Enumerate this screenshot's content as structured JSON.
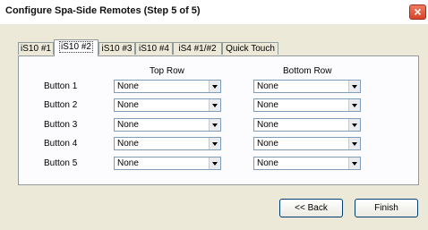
{
  "window": {
    "title": "Configure Spa-Side Remotes (Step 5 of 5)"
  },
  "tabs": [
    {
      "label": "iS10 #1"
    },
    {
      "label": "iS10 #2",
      "active": true
    },
    {
      "label": "iS10 #3"
    },
    {
      "label": "iS10 #4"
    },
    {
      "label": "iS4 #1/#2"
    },
    {
      "label": "Quick Touch"
    }
  ],
  "columns": {
    "top_row": "Top Row",
    "bottom_row": "Bottom Row"
  },
  "rows": [
    {
      "label": "Button 1",
      "top": "None",
      "bottom": "None"
    },
    {
      "label": "Button 2",
      "top": "None",
      "bottom": "None"
    },
    {
      "label": "Button 3",
      "top": "None",
      "bottom": "None"
    },
    {
      "label": "Button 4",
      "top": "None",
      "bottom": "None"
    },
    {
      "label": "Button 5",
      "top": "None",
      "bottom": "None"
    }
  ],
  "buttons": {
    "back": "<< Back",
    "finish": "Finish"
  }
}
